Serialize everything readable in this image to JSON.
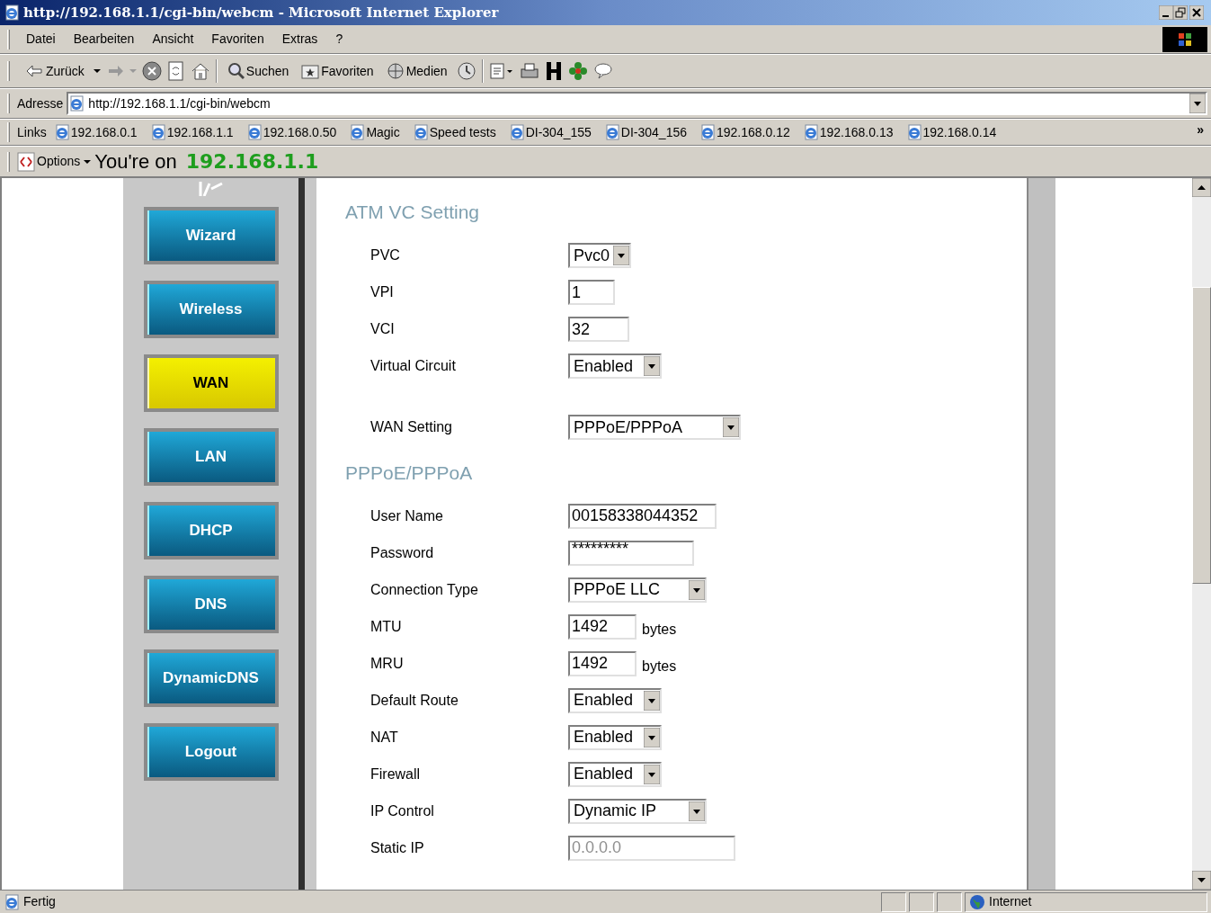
{
  "window": {
    "title": "http://192.168.1.1/cgi-bin/webcm - Microsoft Internet Explorer"
  },
  "menu": [
    {
      "label": "Datei"
    },
    {
      "label": "Bearbeiten"
    },
    {
      "label": "Ansicht"
    },
    {
      "label": "Favoriten"
    },
    {
      "label": "Extras"
    },
    {
      "label": "?"
    }
  ],
  "toolbar": {
    "back": "Zurück",
    "search": "Suchen",
    "favorites": "Favoriten",
    "media": "Medien"
  },
  "address": {
    "label": "Adresse",
    "value": "http://192.168.1.1/cgi-bin/webcm"
  },
  "links": {
    "label": "Links",
    "items": [
      "192.168.0.1",
      "192.168.1.1",
      "192.168.0.50",
      "Magic",
      "Speed tests",
      "DI-304_155",
      "DI-304_156",
      "192.168.0.12",
      "192.168.0.13",
      "192.168.0.14"
    ],
    "more": "»"
  },
  "options_bar": {
    "label": "Options",
    "text": "You're on",
    "host": "192.168.1.1"
  },
  "sidebar": {
    "items": [
      {
        "label": "Wizard",
        "selected": false
      },
      {
        "label": "Wireless",
        "selected": false
      },
      {
        "label": "WAN",
        "selected": true
      },
      {
        "label": "LAN",
        "selected": false
      },
      {
        "label": "DHCP",
        "selected": false
      },
      {
        "label": "DNS",
        "selected": false
      },
      {
        "label": "DynamicDNS",
        "selected": false
      },
      {
        "label": "Logout",
        "selected": false
      }
    ]
  },
  "sections": [
    {
      "title": "ATM VC Setting",
      "fields": [
        {
          "label": "PVC",
          "kind": "select",
          "value": "Pvc0"
        },
        {
          "label": "VPI",
          "kind": "text",
          "value": "1"
        },
        {
          "label": "VCI",
          "kind": "text",
          "value": "32"
        },
        {
          "label": "Virtual Circuit",
          "kind": "select",
          "value": "Enabled"
        },
        {
          "label": "WAN Setting",
          "kind": "select",
          "value": "PPPoE/PPPoA"
        }
      ]
    },
    {
      "title": "PPPoE/PPPoA",
      "fields": [
        {
          "label": "User Name",
          "kind": "text",
          "value": "00158338044352"
        },
        {
          "label": "Password",
          "kind": "password",
          "value": "*********"
        },
        {
          "label": "Connection Type",
          "kind": "select",
          "value": "PPPoE LLC"
        },
        {
          "label": "MTU",
          "kind": "text",
          "value": "1492",
          "unit": "bytes"
        },
        {
          "label": "MRU",
          "kind": "text",
          "value": "1492",
          "unit": "bytes"
        },
        {
          "label": "Default Route",
          "kind": "select",
          "value": "Enabled"
        },
        {
          "label": "NAT",
          "kind": "select",
          "value": "Enabled"
        },
        {
          "label": "Firewall",
          "kind": "select",
          "value": "Enabled"
        },
        {
          "label": "IP Control",
          "kind": "select",
          "value": "Dynamic IP"
        },
        {
          "label": "Static IP",
          "kind": "text",
          "value": "0.0.0.0",
          "disabled": true
        }
      ]
    }
  ],
  "status_bar": {
    "text": "Fertig",
    "zone": "Internet"
  }
}
